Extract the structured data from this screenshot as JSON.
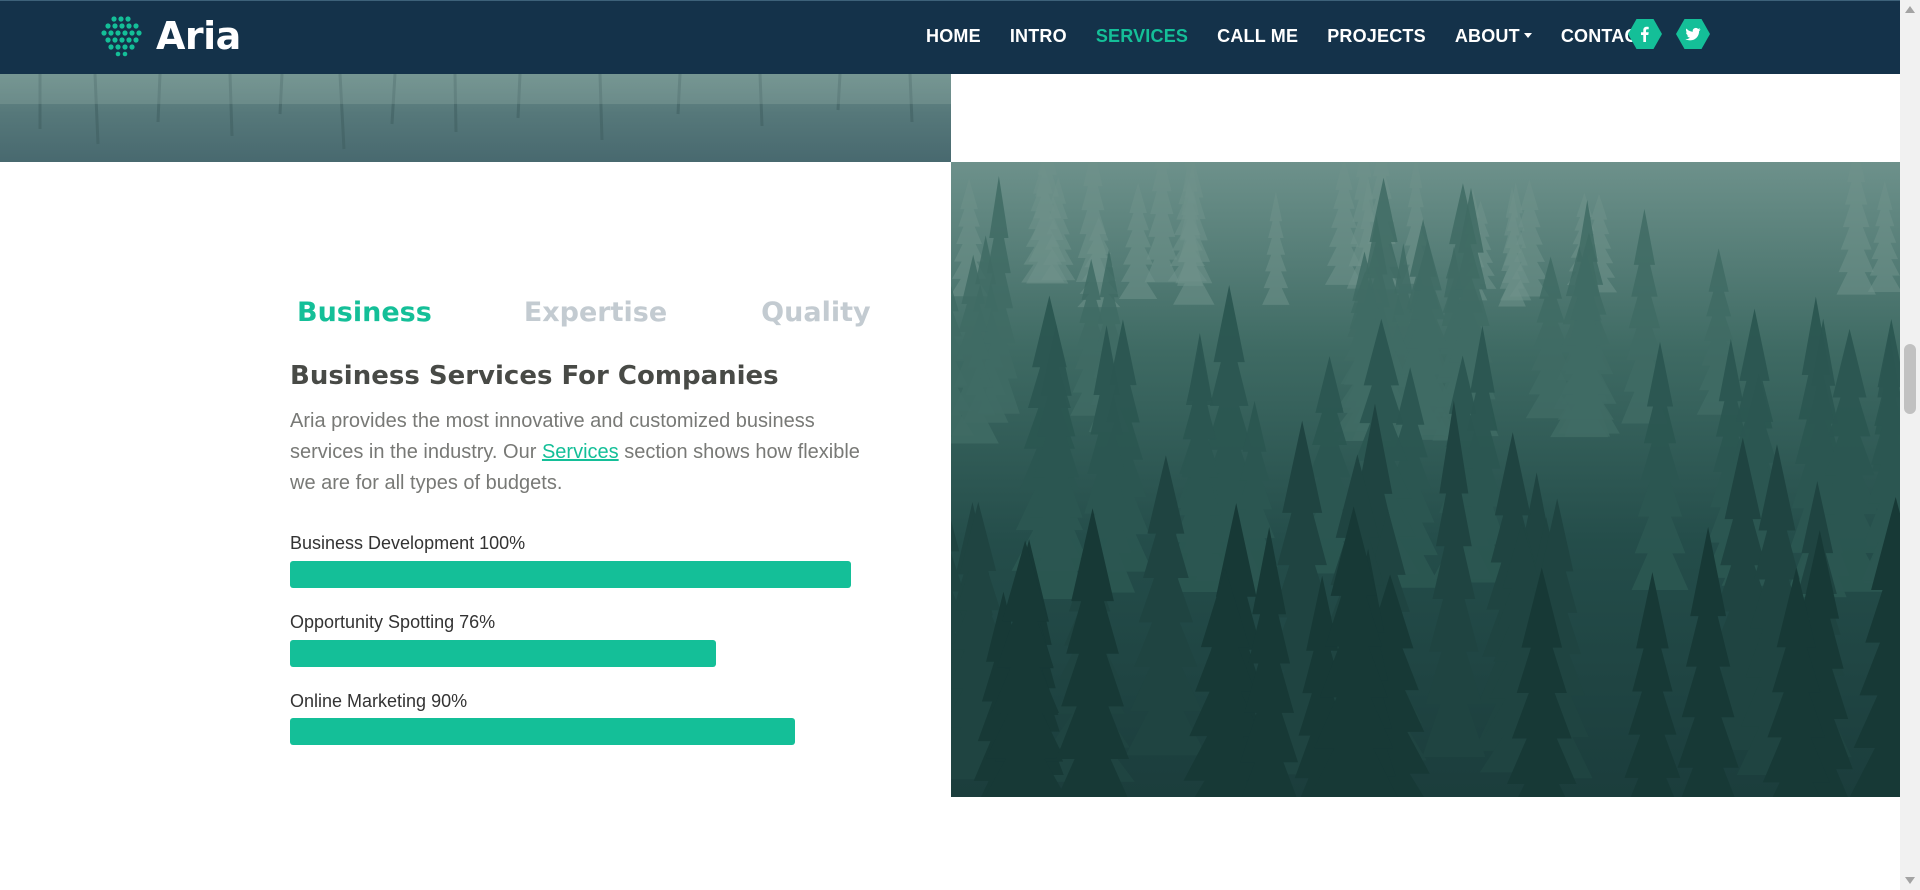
{
  "brand": {
    "name": "Aria",
    "accent": "#14bf98",
    "navbar_bg": "#14324a"
  },
  "nav": {
    "items": [
      {
        "label": "HOME"
      },
      {
        "label": "INTRO"
      },
      {
        "label": "SERVICES",
        "active": true
      },
      {
        "label": "CALL ME"
      },
      {
        "label": "PROJECTS"
      },
      {
        "label": "ABOUT",
        "dropdown": true
      },
      {
        "label": "CONTACT"
      }
    ],
    "social": [
      {
        "icon": "facebook-icon"
      },
      {
        "icon": "twitter-icon"
      }
    ]
  },
  "tabs": [
    {
      "label": "Business",
      "active": true
    },
    {
      "label": "Expertise"
    },
    {
      "label": "Quality"
    }
  ],
  "content": {
    "heading": "Business Services For Companies",
    "desc_before": "Aria provides the most innovative and customized business services in the industry. Our ",
    "desc_link": "Services",
    "desc_after": " section shows how flexible we are for all types of budgets."
  },
  "skills": [
    {
      "label": "Business Development 100%",
      "percent": 100
    },
    {
      "label": "Opportunity Spotting 76%",
      "percent": 76
    },
    {
      "label": "Online Marketing 90%",
      "percent": 90
    }
  ]
}
